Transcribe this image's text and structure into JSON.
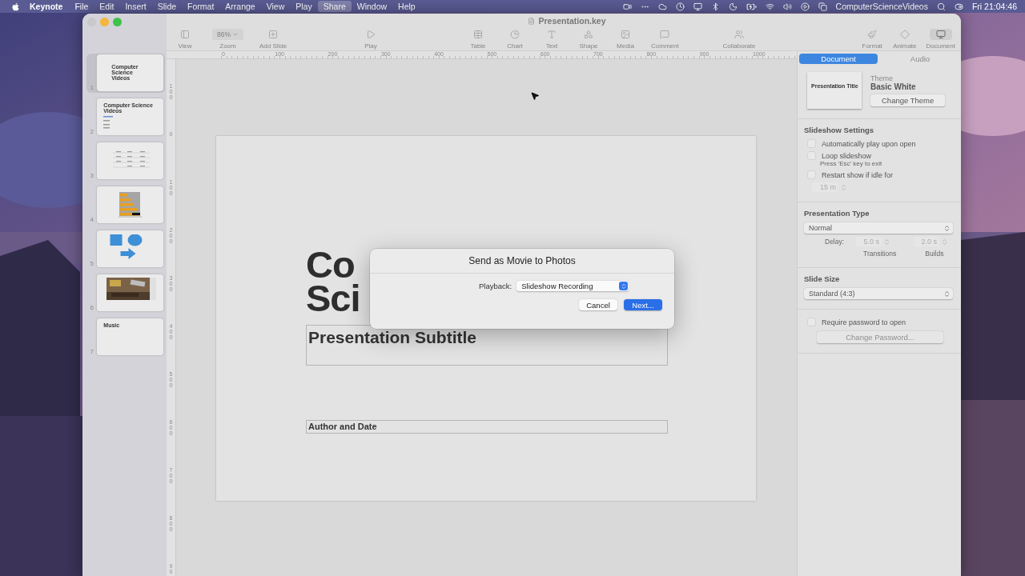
{
  "menu_bar": {
    "app": "Keynote",
    "menus": [
      {
        "label": "File",
        "selected": false
      },
      {
        "label": "Edit",
        "selected": false
      },
      {
        "label": "Insert",
        "selected": false
      },
      {
        "label": "Slide",
        "selected": false
      },
      {
        "label": "Format",
        "selected": false
      },
      {
        "label": "Arrange",
        "selected": false
      },
      {
        "label": "View",
        "selected": false
      },
      {
        "label": "Play",
        "selected": false
      },
      {
        "label": "Share",
        "selected": true
      },
      {
        "label": "Window",
        "selected": false
      },
      {
        "label": "Help",
        "selected": false
      }
    ],
    "account": "ComputerScienceVideos",
    "clock": "Fri 21:04:46"
  },
  "window": {
    "title": "Presentation.key"
  },
  "toolbar": {
    "groups": [
      [
        {
          "kind": "view",
          "label": "View"
        },
        {
          "kind": "zoom",
          "label": "Zoom",
          "value": "86%"
        },
        {
          "kind": "add-slide",
          "label": "Add Slide"
        }
      ],
      [
        {
          "kind": "play",
          "label": "Play"
        }
      ],
      [
        {
          "kind": "table",
          "label": "Table"
        },
        {
          "kind": "chart",
          "label": "Chart"
        },
        {
          "kind": "text",
          "label": "Text"
        },
        {
          "kind": "shape",
          "label": "Shape"
        },
        {
          "kind": "media",
          "label": "Media"
        },
        {
          "kind": "comment",
          "label": "Comment"
        }
      ],
      [
        {
          "kind": "collaborate",
          "label": "Collaborate"
        }
      ],
      [
        {
          "kind": "format",
          "label": "Format",
          "selected": false
        },
        {
          "kind": "animate",
          "label": "Animate",
          "selected": false
        },
        {
          "kind": "document",
          "label": "Document",
          "selected": true
        }
      ]
    ]
  },
  "ruler": {
    "horizontal": [
      "0",
      "100",
      "200",
      "300",
      "400",
      "500",
      "600",
      "700",
      "800",
      "900",
      "1000"
    ],
    "vertical": [
      "100",
      "0",
      "100",
      "200",
      "300",
      "400",
      "500",
      "600",
      "700",
      "800",
      "90"
    ]
  },
  "slides": [
    {
      "number": "1",
      "selected": true,
      "kind": "title",
      "title": "Computer Science Videos"
    },
    {
      "number": "2",
      "selected": false,
      "kind": "bullets",
      "title": "Computer Science Videos"
    },
    {
      "number": "3",
      "selected": false,
      "kind": "table"
    },
    {
      "number": "4",
      "selected": false,
      "kind": "chart"
    },
    {
      "number": "5",
      "selected": false,
      "kind": "shapes"
    },
    {
      "number": "6",
      "selected": false,
      "kind": "picture"
    },
    {
      "number": "7",
      "selected": false,
      "kind": "text",
      "title": "Music"
    }
  ],
  "slide": {
    "title_lines": [
      "Co",
      "Sci"
    ],
    "subtitle": "Presentation Subtitle",
    "author": "Author and Date"
  },
  "inspector": {
    "tabs": [
      {
        "label": "Document",
        "selected": true
      },
      {
        "label": "Audio",
        "selected": false
      }
    ],
    "theme": {
      "label": "Theme",
      "name": "Basic White",
      "thumbnail_title": "Presentation Title",
      "button": "Change Theme"
    },
    "slideshow": {
      "heading": "Slideshow Settings",
      "options": [
        {
          "label": "Automatically play upon open",
          "checked": false
        },
        {
          "label": "Loop slideshow",
          "checked": false,
          "note": "Press 'Esc' key to exit"
        },
        {
          "label": "Restart show if idle for",
          "checked": false
        }
      ],
      "idle_time": "15 m"
    },
    "presentation_type": {
      "heading": "Presentation Type",
      "value": "Normal",
      "delay_label": "Delay:",
      "transitions": "5.0 s",
      "builds": "2.0 s",
      "transitions_label": "Transitions",
      "builds_label": "Builds"
    },
    "slide_size": {
      "heading": "Slide Size",
      "value": "Standard (4:3)"
    },
    "password": {
      "label": "Require password to open",
      "checked": false,
      "button": "Change Password...",
      "disabled": true
    }
  },
  "dialog": {
    "title": "Send as Movie to Photos",
    "playback_label": "Playback:",
    "playback_value": "Slideshow Recording",
    "buttons": [
      {
        "label": "Cancel",
        "default": false
      },
      {
        "label": "Next...",
        "default": true
      }
    ]
  }
}
